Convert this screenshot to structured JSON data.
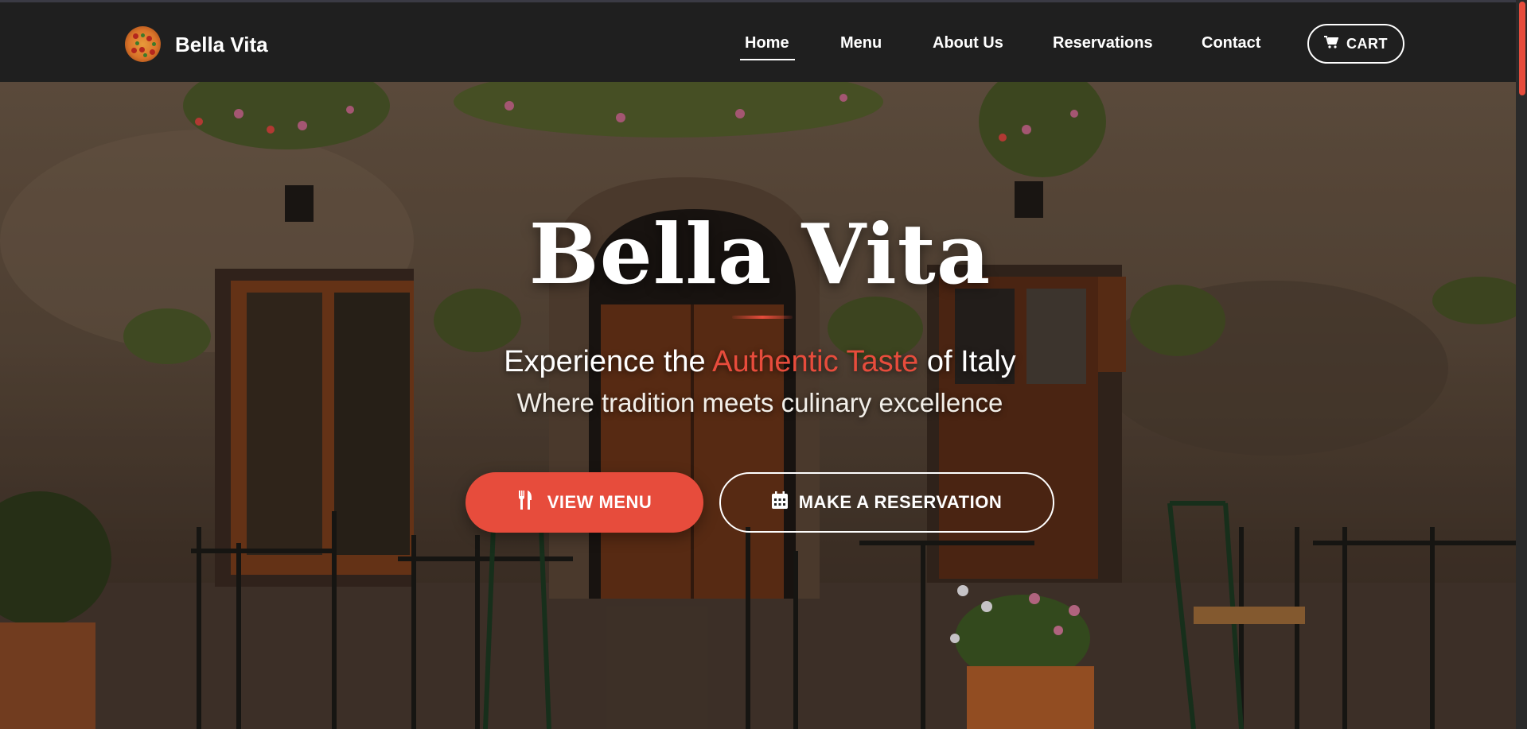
{
  "header": {
    "brand": "Bella Vita",
    "nav": [
      {
        "label": "Home",
        "active": true
      },
      {
        "label": "Menu",
        "active": false
      },
      {
        "label": "About Us",
        "active": false
      },
      {
        "label": "Reservations",
        "active": false
      },
      {
        "label": "Contact",
        "active": false
      }
    ],
    "cart_label": "CART",
    "cart_icon": "shopping-cart-icon"
  },
  "hero": {
    "title": "Bella Vita",
    "tagline_before": "Experience the ",
    "tagline_accent": "Authentic Taste",
    "tagline_after": " of Italy",
    "subtagline": "Where tradition meets culinary excellence",
    "primary_button": {
      "label": "VIEW MENU",
      "icon": "utensils-icon"
    },
    "secondary_button": {
      "label": "MAKE A RESERVATION",
      "icon": "calendar-icon"
    }
  },
  "colors": {
    "accent": "#e74c3c",
    "navbar_bg": "#1f1f1f",
    "text_light": "#ffffff"
  }
}
